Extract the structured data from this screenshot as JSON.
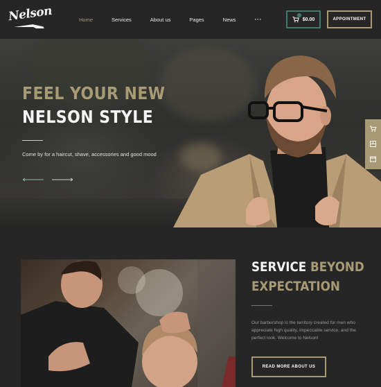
{
  "brand": {
    "logo_text": "Nelson"
  },
  "nav": {
    "items": [
      {
        "label": "Home",
        "active": true
      },
      {
        "label": "Services",
        "active": false
      },
      {
        "label": "About us",
        "active": false
      },
      {
        "label": "Pages",
        "active": false
      },
      {
        "label": "News",
        "active": false
      }
    ],
    "more_label": "···"
  },
  "cart": {
    "total": "$0.00",
    "icon": "cart-icon"
  },
  "appointment": {
    "label": "APPOINTMENT"
  },
  "hero": {
    "title_line1": "FEEL YOUR NEW",
    "title_line2": "NELSON STYLE",
    "subtitle": "Come by for a haircut, shave, accessories and good mood"
  },
  "side_tabs": [
    "cart-icon",
    "layout-icon",
    "window-icon"
  ],
  "service": {
    "title_white": "SERVICE ",
    "title_gold": "BEYOND",
    "title_line2": "EXPECTATION",
    "description": "Our barbershop is the territory created for men who appreciate high quality, impeccable service, and the perfect look. Welcome to Nelson!",
    "button_label": "READ MORE ABOUT US"
  },
  "colors": {
    "accent_gold": "#a79a74",
    "accent_teal": "#3f7a6e",
    "background": "#262626"
  }
}
